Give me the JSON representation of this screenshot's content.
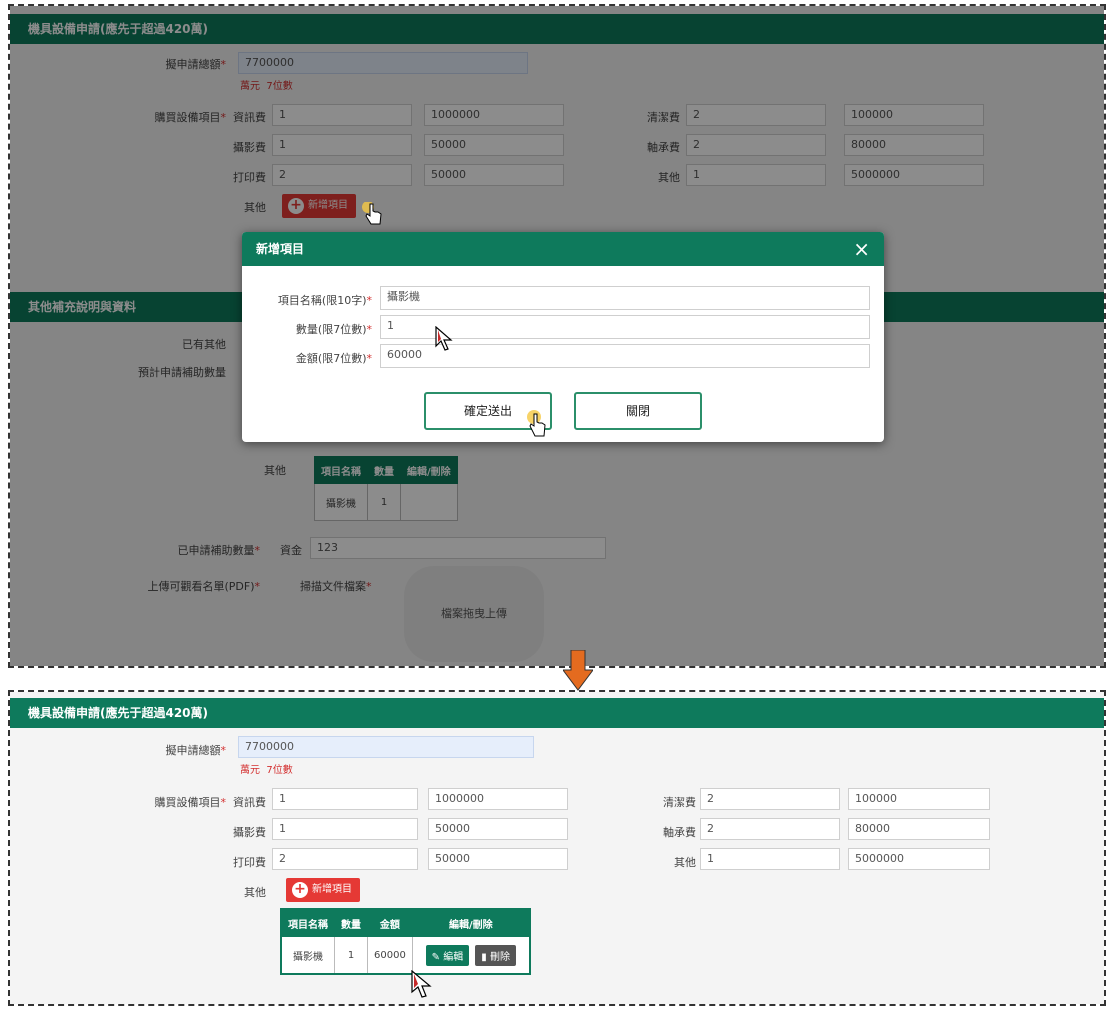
{
  "form": {
    "section_title": "機具設備申請(應先于超過420萬)",
    "apply_amount_label": "擬申請總額",
    "apply_amount_value": "7700000",
    "apply_amount_hint": "萬元",
    "apply_amount_hint_unit": "7位數",
    "equipment_label": "購買設備項目",
    "items_left": [
      {
        "name": "資訊費",
        "qty": "1",
        "amount": "1000000"
      },
      {
        "name": "攝影費",
        "qty": "1",
        "amount": "50000"
      },
      {
        "name": "打印費",
        "qty": "2",
        "amount": "50000"
      }
    ],
    "items_right": [
      {
        "name": "清潔費",
        "qty": "2",
        "amount": "100000"
      },
      {
        "name": "軸承費",
        "qty": "2",
        "amount": "80000"
      },
      {
        "name": "其他",
        "qty": "1",
        "amount": "5000000"
      }
    ],
    "other_label": "其他",
    "add_button_label": "新增項目"
  },
  "top_screen": {
    "section2_title": "其他補充說明與資料",
    "line1_label": "已有其他",
    "line2_label": "預計申請補助數量",
    "table_other_label": "其他",
    "mini_table_headers": [
      "項目名稱",
      "數量",
      "編輯/刪除"
    ],
    "mini_table_row": [
      "攝影機",
      "1",
      ""
    ],
    "requested_label": "已申請補助數量",
    "requested_value_label": "資金",
    "requested_value": "123",
    "upload_row_label": "上傳可觀看名單(PDF)",
    "upload_sub_label": "掃描文件檔案",
    "upload_button": "檔案拖曳上傳"
  },
  "modal": {
    "title": "新增項目",
    "close_icon": "×",
    "field_name_label": "項目名稱(限10字)",
    "field_name_value": "攝影機",
    "field_qty_label": "數量(限7位數)",
    "field_qty_value": "1",
    "field_amount_label": "金額(限7位數)",
    "field_amount_value": "60000",
    "confirm_button": "確定送出",
    "cancel_button": "關閉"
  },
  "result_table": {
    "headers": [
      "項目名稱",
      "數量",
      "金額",
      "編輯/刪除"
    ],
    "row": {
      "name": "攝影機",
      "qty": "1",
      "amount": "60000"
    },
    "edit_label": "編輯",
    "delete_label": "刪除"
  }
}
